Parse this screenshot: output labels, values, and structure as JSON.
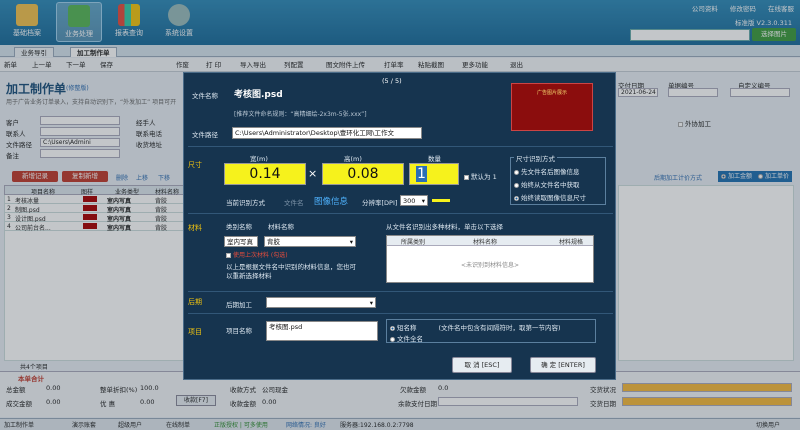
{
  "nav": [
    {
      "label": "基础档案",
      "icon": "basket-icon"
    },
    {
      "label": "业务处理",
      "icon": "calculator-icon"
    },
    {
      "label": "报表查询",
      "icon": "barchart-icon"
    },
    {
      "label": "系统设置",
      "icon": "gear-icon"
    }
  ],
  "toplinks": [
    "公司资料",
    "修改密码",
    "在线客服"
  ],
  "version": "标准版 V2.3.0.311",
  "select_image": "选择图片",
  "tabs": [
    "业务导引",
    "加工制作单"
  ],
  "toolbar": [
    "新单",
    "上一单",
    "下一单",
    "保存",
    "作废",
    "打 印",
    "导入导出",
    "列配置",
    "图文附件上传",
    "打单率",
    "粘贴截图",
    "更多功能",
    "退出"
  ],
  "left": {
    "title": "加工制作单",
    "title_note": "(修整版)",
    "hint": "用于广告业务订单录入，支持自动识别下，“外发加工” 项目可开",
    "fields": [
      {
        "label": "客户",
        "value": ""
      },
      {
        "label": "联系人",
        "value": ""
      },
      {
        "label": "文件路径",
        "value": "C:\\Users\\Admini"
      },
      {
        "label": "备注",
        "value": ""
      }
    ],
    "fields2": [
      "经手人",
      "联系电话",
      "收货地址"
    ],
    "btn_add": "新增记录",
    "btn_copy": "复制新增",
    "links": [
      "删除",
      "上移",
      "下移"
    ],
    "grid_headers": [
      "项目名称",
      "图样",
      "业务类型",
      "材料名称"
    ],
    "rows": [
      {
        "n": "1",
        "name": "考核冰量",
        "type": "室内写真",
        "mat": "背胶"
      },
      {
        "n": "2",
        "name": "制图.psd",
        "type": "室内写真",
        "mat": "背胶"
      },
      {
        "n": "3",
        "name": "设计图.psd",
        "type": "室内写真",
        "mat": "背胶"
      },
      {
        "n": "4",
        "name": "公司前台名...",
        "type": "室内写真",
        "mat": "背胶"
      }
    ],
    "row_count": "共4个项目"
  },
  "right_panel": {
    "labels": [
      "交付日期",
      "单据编号",
      "自定义编号"
    ],
    "date": "2021-06-24",
    "outsource": "外协加工",
    "link": "后期加工计价方式",
    "radios": [
      "加工金额",
      "加工单价"
    ]
  },
  "modal": {
    "counter": "(5 / 5)",
    "file_label": "文件名称",
    "file_name": "考核图.psd",
    "naming_hint": "[推荐文件命名规则：“高精细绘-2x3m-5张.xxx”]",
    "path_label": "文件路径",
    "path": "C:\\Users\\Administrator\\Desktop\\壹环化工网\\工作文",
    "preview_text": "广告图片展示",
    "sect_size": "尺寸",
    "width_label": "宽(m)",
    "height_label": "高(m)",
    "qty_label": "数量",
    "width": "0.14",
    "height": "0.08",
    "qty": "1",
    "default1": "默认为 1",
    "size_mode_title": "尺寸识别方式",
    "size_modes": [
      "先文件名后图像信息",
      "始终从文件名中获取",
      "始终读取图像信息尺寸"
    ],
    "cur_mode_label": "当前识别方式",
    "mode_filename": "文件名",
    "mode_imginfo": "图像信息",
    "dpi_label": "分辨率[DPI]",
    "dpi": "300",
    "sect_material": "材料",
    "cat_label": "类别名称",
    "mat_label": "材料名称",
    "cat_value": "室内写真",
    "mat_value": "背胶",
    "use_last": "使用上次材料 (勾选)",
    "mat_note": "以上是根据文件名中识别的材料信息，您也可以重新选择材料",
    "multi_title": "从文件名识别出多种材料，单击以下选择",
    "multi_headers": [
      "所属类别",
      "材料名称",
      "材料规格"
    ],
    "multi_empty": "<未识别到材料信息>",
    "sect_post": "后期",
    "post_label": "后期加工",
    "sect_item": "项目",
    "item_label": "项目名称",
    "item_value": "考核图.psd",
    "short_name": "短名称",
    "short_note": "(文件名中包含有间隔符时，取第一节内容)",
    "full_name": "文件全名",
    "cancel": "取 消 [ESC]",
    "ok": "确 定 [ENTER]"
  },
  "totals": {
    "title": "本单合计",
    "rows": [
      {
        "l": "总金额",
        "v": "0.00",
        "l2": "整单折扣(%)",
        "v2": "100.0"
      },
      {
        "l": "成交金额",
        "v": "0.00",
        "l2": "优 惠",
        "v2": "0.00"
      }
    ],
    "pay_btn": "收款[F7]",
    "mid": [
      {
        "l": "收款方式",
        "v": "公司现金"
      },
      {
        "l": "收款金额",
        "v": "0.00"
      }
    ],
    "debt": [
      {
        "l": "欠款金额",
        "v": "0.0"
      },
      {
        "l": "余款支付日期",
        "v": ""
      }
    ],
    "deliver": [
      "交货状况",
      "交货日期"
    ]
  },
  "statusbar": [
    "加工制作单",
    "演示账套",
    "超级用户",
    "在线制单",
    "正版授权 | 可多使用",
    "网络情况: 良好",
    "服务器:192.168.0.2:7798",
    "切换用户"
  ],
  "colors": {
    "banner": "#1f78a8",
    "modal": "#16344f",
    "yellow": "#f6f21c",
    "red": "#c0392b"
  }
}
